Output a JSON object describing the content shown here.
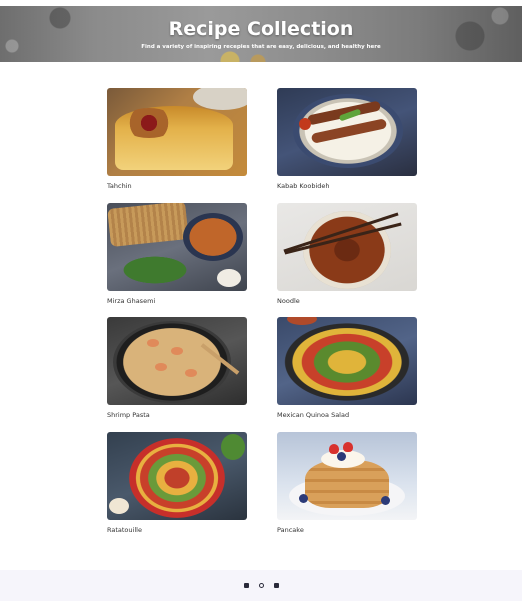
{
  "hero": {
    "title": "Recipe Collection",
    "subtitle": "Find a variety of inspiring recepies that are easy, delicious, and healthy here"
  },
  "recipes": [
    {
      "name": "Tahchin"
    },
    {
      "name": "Kabab Koobideh"
    },
    {
      "name": "Mirza Ghasemi"
    },
    {
      "name": "Noodle"
    },
    {
      "name": "Shrimp Pasta"
    },
    {
      "name": "Mexican Quinoa Salad"
    },
    {
      "name": "Ratatouille"
    },
    {
      "name": "Pancake"
    }
  ],
  "footer": {
    "icons": [
      "facebook-icon",
      "instagram-icon",
      "linkedin-icon"
    ]
  }
}
